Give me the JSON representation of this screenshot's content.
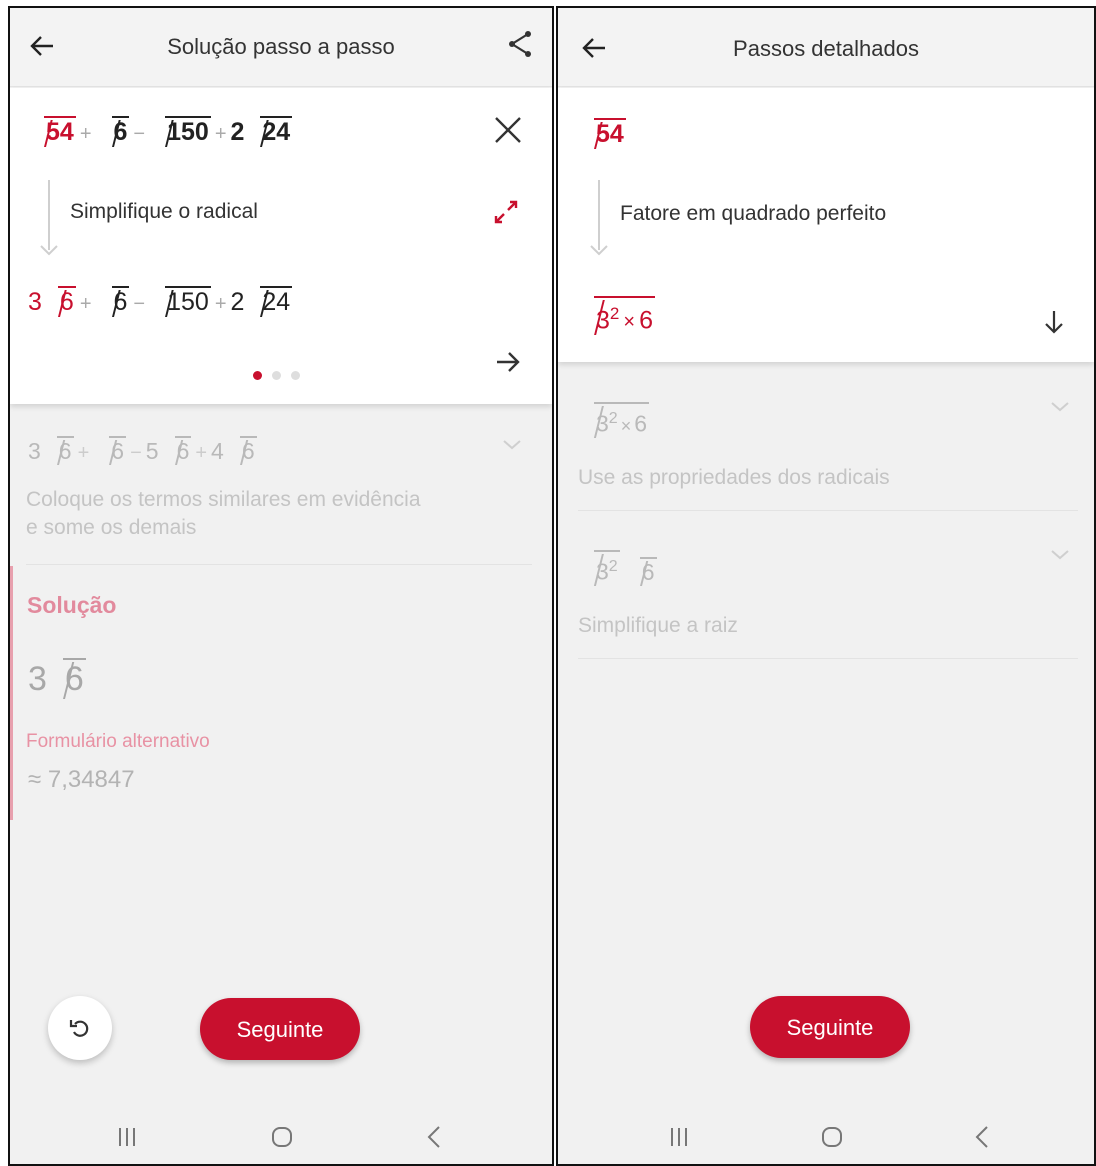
{
  "left": {
    "header": {
      "title": "Solução passo a passo"
    },
    "card": {
      "expr_top": {
        "r1": "54",
        "r2": "6",
        "r3": "150",
        "c4": "2",
        "r4": "24"
      },
      "step_label": "Simplifique o radical",
      "expr_result": {
        "c1": "3",
        "r1": "6",
        "r2": "6",
        "r3": "150",
        "c4": "2",
        "r4": "24"
      },
      "pager": {
        "total": 3,
        "active": 1
      }
    },
    "next_step": {
      "expr": {
        "c1": "3",
        "r1": "6",
        "r2": "6",
        "c3": "5",
        "r3": "6",
        "c4": "4",
        "r4": "6"
      },
      "description_line1": "Coloque os termos similares em evidência",
      "description_line2": "e some os demais"
    },
    "solution": {
      "heading": "Solução",
      "coef": "3",
      "radicand": "6",
      "alt_label": "Formulário alternativo",
      "alt_value": "≈ 7,34847"
    },
    "buttons": {
      "next_label": "Seguinte"
    }
  },
  "right": {
    "header": {
      "title": "Passos detalhados"
    },
    "card": {
      "expr_top": "54",
      "step_label": "Fatore em quadrado perfeito",
      "expr_result": {
        "base": "3",
        "exp": "2",
        "times": "×",
        "factor": "6"
      }
    },
    "steps": [
      {
        "base": "3",
        "exp": "2",
        "times": "×",
        "factor": "6",
        "description": "Use as propriedades dos radicais"
      },
      {
        "base": "3",
        "exp": "2",
        "radicand2": "6",
        "description": "Simplifique a raiz"
      }
    ],
    "buttons": {
      "next_label": "Seguinte"
    }
  },
  "colors": {
    "accent": "#c8102e",
    "background": "#f1f1f1",
    "card": "#ffffff",
    "muted": "#c4c4c4"
  }
}
